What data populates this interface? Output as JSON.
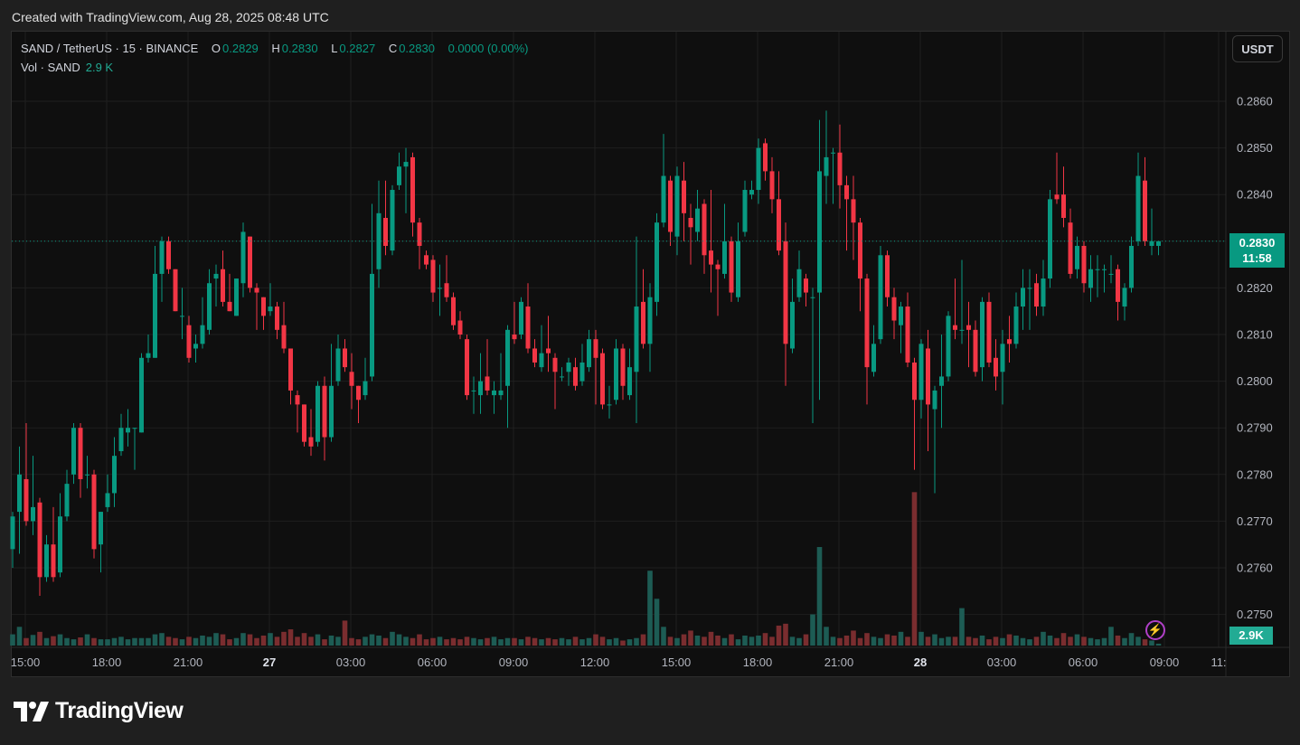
{
  "watermark": "Created with TradingView.com, Aug 28, 2025 08:48 UTC",
  "legend": {
    "symbol": "SAND / TetherUS · 15 · BINANCE",
    "o_label": "O",
    "o": "0.2829",
    "h_label": "H",
    "h": "0.2830",
    "l_label": "L",
    "l": "0.2827",
    "c_label": "C",
    "c": "0.2830",
    "change": "0.0000 (0.00%)"
  },
  "volume_legend": {
    "label": "Vol · SAND",
    "value": "2.9 K"
  },
  "currency_button": "USDT",
  "current_price": {
    "price": "0.2830",
    "countdown": "11:58"
  },
  "current_volume": "2.9K",
  "logo": "TradingView",
  "icons": {
    "alert": "lightning-icon",
    "logo": "tradingview-logo-icon"
  },
  "colors": {
    "up": "#089981",
    "down": "#f23645",
    "vol_up": "#1d5c54",
    "vol_down": "#7a2d2f",
    "alert": "#b040c8"
  },
  "chart_data": {
    "type": "candlestick",
    "title": "SAND / TetherUS · 15 · BINANCE",
    "interval_minutes": 15,
    "ylim": [
      0.2745,
      0.2864
    ],
    "current_price": 0.283,
    "y_ticks": [
      "0.2750",
      "0.2760",
      "0.2770",
      "0.2780",
      "0.2790",
      "0.2800",
      "0.2810",
      "0.2820",
      "0.2830",
      "0.2840",
      "0.2850",
      "0.2860"
    ],
    "x_ticks": [
      {
        "label": "15:00",
        "candle": 3
      },
      {
        "label": "18:00",
        "candle": 15
      },
      {
        "label": "21:00",
        "candle": 27
      },
      {
        "label": "27",
        "candle": 39,
        "bold": true
      },
      {
        "label": "03:00",
        "candle": 51
      },
      {
        "label": "06:00",
        "candle": 63
      },
      {
        "label": "09:00",
        "candle": 75
      },
      {
        "label": "12:00",
        "candle": 87
      },
      {
        "label": "15:00",
        "candle": 99
      },
      {
        "label": "18:00",
        "candle": 111
      },
      {
        "label": "21:00",
        "candle": 123
      },
      {
        "label": "28",
        "candle": 135,
        "bold": true
      },
      {
        "label": "03:00",
        "candle": 147
      },
      {
        "label": "06:00",
        "candle": 159
      },
      {
        "label": "09:00",
        "candle": 171
      },
      {
        "label": "11:",
        "candle": 179
      }
    ],
    "ohlc": [
      [
        0.2764,
        0.2772,
        0.276,
        0.2771
      ],
      [
        0.2772,
        0.2786,
        0.2763,
        0.278
      ],
      [
        0.2779,
        0.2791,
        0.2769,
        0.277
      ],
      [
        0.277,
        0.2784,
        0.2767,
        0.2773
      ],
      [
        0.2774,
        0.2775,
        0.2754,
        0.2758
      ],
      [
        0.2758,
        0.2767,
        0.2757,
        0.2765
      ],
      [
        0.2765,
        0.2773,
        0.2757,
        0.2758
      ],
      [
        0.2759,
        0.2776,
        0.2758,
        0.2771
      ],
      [
        0.2771,
        0.2781,
        0.277,
        0.2778
      ],
      [
        0.278,
        0.2791,
        0.2778,
        0.279
      ],
      [
        0.279,
        0.2791,
        0.2775,
        0.2779
      ],
      [
        0.278,
        0.2784,
        0.2777,
        0.278
      ],
      [
        0.278,
        0.2781,
        0.2762,
        0.2764
      ],
      [
        0.2765,
        0.2772,
        0.2759,
        0.2772
      ],
      [
        0.2773,
        0.278,
        0.2772,
        0.2776
      ],
      [
        0.2776,
        0.2788,
        0.2773,
        0.2784
      ],
      [
        0.2785,
        0.2793,
        0.2784,
        0.279
      ],
      [
        0.2789,
        0.2794,
        0.2786,
        0.279
      ],
      [
        0.279,
        0.279,
        0.2781,
        0.279
      ],
      [
        0.2789,
        0.2806,
        0.2789,
        0.2805
      ],
      [
        0.2805,
        0.281,
        0.2804,
        0.2806
      ],
      [
        0.2805,
        0.2829,
        0.2805,
        0.2823
      ],
      [
        0.2823,
        0.2831,
        0.2817,
        0.283
      ],
      [
        0.283,
        0.2831,
        0.2823,
        0.2824
      ],
      [
        0.2824,
        0.2824,
        0.2815,
        0.2815
      ],
      [
        0.2814,
        0.282,
        0.2809,
        0.2814
      ],
      [
        0.2812,
        0.2814,
        0.2804,
        0.2805
      ],
      [
        0.2807,
        0.281,
        0.2804,
        0.2808
      ],
      [
        0.2808,
        0.2818,
        0.2807,
        0.2812
      ],
      [
        0.2811,
        0.2824,
        0.281,
        0.2821
      ],
      [
        0.2822,
        0.2825,
        0.2816,
        0.2823
      ],
      [
        0.2824,
        0.2828,
        0.2816,
        0.2817
      ],
      [
        0.2817,
        0.2823,
        0.2815,
        0.2815
      ],
      [
        0.2814,
        0.2822,
        0.2814,
        0.2822
      ],
      [
        0.2821,
        0.2834,
        0.2818,
        0.2832
      ],
      [
        0.2831,
        0.2831,
        0.2819,
        0.282
      ],
      [
        0.282,
        0.2821,
        0.2811,
        0.2819
      ],
      [
        0.2818,
        0.2818,
        0.2811,
        0.2814
      ],
      [
        0.2815,
        0.2821,
        0.2814,
        0.2816
      ],
      [
        0.2816,
        0.2817,
        0.2809,
        0.2811
      ],
      [
        0.2812,
        0.2817,
        0.2806,
        0.2807
      ],
      [
        0.2807,
        0.2807,
        0.2795,
        0.2798
      ],
      [
        0.2797,
        0.2798,
        0.2789,
        0.2795
      ],
      [
        0.2795,
        0.2795,
        0.2786,
        0.2787
      ],
      [
        0.2788,
        0.2794,
        0.2784,
        0.2786
      ],
      [
        0.2787,
        0.28,
        0.2786,
        0.2799
      ],
      [
        0.2799,
        0.2801,
        0.2783,
        0.2788
      ],
      [
        0.2788,
        0.2808,
        0.2787,
        0.2799
      ],
      [
        0.28,
        0.281,
        0.2799,
        0.2807
      ],
      [
        0.2807,
        0.2809,
        0.2802,
        0.2803
      ],
      [
        0.2802,
        0.2806,
        0.2794,
        0.2799
      ],
      [
        0.2799,
        0.2799,
        0.2791,
        0.2796
      ],
      [
        0.2797,
        0.2805,
        0.2796,
        0.28
      ],
      [
        0.2801,
        0.2838,
        0.28,
        0.2823
      ],
      [
        0.2824,
        0.2843,
        0.282,
        0.2836
      ],
      [
        0.2835,
        0.2843,
        0.2827,
        0.2829
      ],
      [
        0.2828,
        0.2842,
        0.2827,
        0.2841
      ],
      [
        0.2842,
        0.2849,
        0.2841,
        0.2846
      ],
      [
        0.2846,
        0.285,
        0.2836,
        0.2847
      ],
      [
        0.2848,
        0.2849,
        0.2831,
        0.2834
      ],
      [
        0.2834,
        0.2835,
        0.2824,
        0.2829
      ],
      [
        0.2827,
        0.2828,
        0.2824,
        0.2825
      ],
      [
        0.2826,
        0.2827,
        0.2817,
        0.2819
      ],
      [
        0.282,
        0.2825,
        0.2814,
        0.282
      ],
      [
        0.2821,
        0.2827,
        0.2817,
        0.2818
      ],
      [
        0.2818,
        0.2819,
        0.2811,
        0.2812
      ],
      [
        0.2813,
        0.2815,
        0.2809,
        0.281
      ],
      [
        0.2809,
        0.281,
        0.2796,
        0.2797
      ],
      [
        0.2798,
        0.2801,
        0.2793,
        0.2798
      ],
      [
        0.2797,
        0.2806,
        0.2793,
        0.28
      ],
      [
        0.2801,
        0.2809,
        0.2797,
        0.2798
      ],
      [
        0.2797,
        0.28,
        0.2793,
        0.2798
      ],
      [
        0.2797,
        0.2806,
        0.2796,
        0.2798
      ],
      [
        0.2799,
        0.2812,
        0.279,
        0.2811
      ],
      [
        0.281,
        0.2817,
        0.2808,
        0.2809
      ],
      [
        0.281,
        0.2818,
        0.2809,
        0.2817
      ],
      [
        0.2816,
        0.2821,
        0.2806,
        0.2807
      ],
      [
        0.2807,
        0.2809,
        0.2803,
        0.2804
      ],
      [
        0.2803,
        0.2812,
        0.2802,
        0.2806
      ],
      [
        0.2807,
        0.2814,
        0.2802,
        0.2806
      ],
      [
        0.2805,
        0.2806,
        0.2794,
        0.2802
      ],
      [
        0.2801,
        0.2803,
        0.28,
        0.2801
      ],
      [
        0.2802,
        0.2805,
        0.2799,
        0.2804
      ],
      [
        0.2803,
        0.2805,
        0.2798,
        0.2799
      ],
      [
        0.28,
        0.2808,
        0.2799,
        0.2804
      ],
      [
        0.2803,
        0.2811,
        0.2802,
        0.2809
      ],
      [
        0.2809,
        0.2811,
        0.2795,
        0.2805
      ],
      [
        0.2806,
        0.2807,
        0.2794,
        0.2795
      ],
      [
        0.2795,
        0.2799,
        0.2792,
        0.2795
      ],
      [
        0.2796,
        0.2809,
        0.2795,
        0.2807
      ],
      [
        0.2807,
        0.2808,
        0.2796,
        0.2799
      ],
      [
        0.2797,
        0.2807,
        0.2796,
        0.2803
      ],
      [
        0.2802,
        0.2831,
        0.2791,
        0.2816
      ],
      [
        0.2817,
        0.2824,
        0.2807,
        0.2808
      ],
      [
        0.2808,
        0.2821,
        0.2802,
        0.2818
      ],
      [
        0.2817,
        0.2836,
        0.2814,
        0.2834
      ],
      [
        0.2834,
        0.2853,
        0.2833,
        0.2844
      ],
      [
        0.2843,
        0.2844,
        0.2829,
        0.2832
      ],
      [
        0.2831,
        0.2846,
        0.2827,
        0.2844
      ],
      [
        0.2843,
        0.2847,
        0.283,
        0.2836
      ],
      [
        0.2835,
        0.2838,
        0.2825,
        0.2833
      ],
      [
        0.2832,
        0.2841,
        0.283,
        0.2837
      ],
      [
        0.2838,
        0.2839,
        0.2823,
        0.2827
      ],
      [
        0.2828,
        0.2841,
        0.2819,
        0.2825
      ],
      [
        0.2825,
        0.2826,
        0.2814,
        0.2824
      ],
      [
        0.2823,
        0.2838,
        0.2822,
        0.283
      ],
      [
        0.283,
        0.2831,
        0.2817,
        0.2819
      ],
      [
        0.2818,
        0.2834,
        0.2817,
        0.283
      ],
      [
        0.2832,
        0.2843,
        0.2831,
        0.2841
      ],
      [
        0.284,
        0.2843,
        0.2839,
        0.2841
      ],
      [
        0.2841,
        0.2852,
        0.2838,
        0.285
      ],
      [
        0.2851,
        0.2852,
        0.2843,
        0.2845
      ],
      [
        0.2845,
        0.2848,
        0.2836,
        0.2839
      ],
      [
        0.2839,
        0.2845,
        0.2827,
        0.2828
      ],
      [
        0.283,
        0.2834,
        0.2799,
        0.2808
      ],
      [
        0.2807,
        0.2822,
        0.2806,
        0.2817
      ],
      [
        0.2818,
        0.2828,
        0.2817,
        0.2824
      ],
      [
        0.2822,
        0.2823,
        0.2816,
        0.2819
      ],
      [
        0.2818,
        0.282,
        0.2791,
        0.2818
      ],
      [
        0.2819,
        0.2856,
        0.2796,
        0.2845
      ],
      [
        0.2844,
        0.2858,
        0.2838,
        0.2848
      ],
      [
        0.2849,
        0.285,
        0.2838,
        0.2849
      ],
      [
        0.2849,
        0.2855,
        0.2837,
        0.2842
      ],
      [
        0.2842,
        0.2844,
        0.2828,
        0.2839
      ],
      [
        0.2839,
        0.2844,
        0.2826,
        0.2834
      ],
      [
        0.2834,
        0.2835,
        0.2815,
        0.2822
      ],
      [
        0.2822,
        0.2823,
        0.2795,
        0.2803
      ],
      [
        0.2802,
        0.2812,
        0.2801,
        0.2808
      ],
      [
        0.2809,
        0.2829,
        0.2808,
        0.2827
      ],
      [
        0.2827,
        0.2828,
        0.2816,
        0.2818
      ],
      [
        0.2818,
        0.282,
        0.2809,
        0.2813
      ],
      [
        0.2812,
        0.2817,
        0.2806,
        0.2816
      ],
      [
        0.2816,
        0.2819,
        0.2803,
        0.2804
      ],
      [
        0.2804,
        0.2805,
        0.2781,
        0.2796
      ],
      [
        0.2796,
        0.2809,
        0.2792,
        0.2808
      ],
      [
        0.2807,
        0.2811,
        0.2785,
        0.2795
      ],
      [
        0.2794,
        0.2799,
        0.2776,
        0.2798
      ],
      [
        0.2799,
        0.281,
        0.279,
        0.2801
      ],
      [
        0.2801,
        0.2815,
        0.28,
        0.2814
      ],
      [
        0.2812,
        0.2822,
        0.2809,
        0.2811
      ],
      [
        0.2811,
        0.2826,
        0.2808,
        0.2811
      ],
      [
        0.2812,
        0.2817,
        0.2803,
        0.2811
      ],
      [
        0.2811,
        0.2813,
        0.2801,
        0.2802
      ],
      [
        0.2803,
        0.2818,
        0.28,
        0.2817
      ],
      [
        0.2817,
        0.2819,
        0.2803,
        0.2804
      ],
      [
        0.2805,
        0.2809,
        0.2798,
        0.2801
      ],
      [
        0.2802,
        0.2811,
        0.2795,
        0.2808
      ],
      [
        0.2809,
        0.2814,
        0.2804,
        0.2808
      ],
      [
        0.2808,
        0.2819,
        0.2807,
        0.2816
      ],
      [
        0.2816,
        0.2824,
        0.2811,
        0.282
      ],
      [
        0.282,
        0.2824,
        0.2811,
        0.282
      ],
      [
        0.2821,
        0.2823,
        0.2814,
        0.2816
      ],
      [
        0.2816,
        0.2826,
        0.2814,
        0.2822
      ],
      [
        0.2822,
        0.2841,
        0.282,
        0.2839
      ],
      [
        0.284,
        0.2849,
        0.2838,
        0.2839
      ],
      [
        0.284,
        0.2846,
        0.2833,
        0.2835
      ],
      [
        0.2834,
        0.2837,
        0.2822,
        0.2823
      ],
      [
        0.2824,
        0.2831,
        0.2822,
        0.2829
      ],
      [
        0.2829,
        0.283,
        0.2819,
        0.2821
      ],
      [
        0.282,
        0.2827,
        0.2817,
        0.2824
      ],
      [
        0.2824,
        0.2827,
        0.2818,
        0.2824
      ],
      [
        0.2824,
        0.2825,
        0.2819,
        0.2824
      ],
      [
        0.2823,
        0.2827,
        0.2821,
        0.2823
      ],
      [
        0.2824,
        0.2825,
        0.2813,
        0.2817
      ],
      [
        0.2816,
        0.2821,
        0.2813,
        0.282
      ],
      [
        0.282,
        0.2831,
        0.2819,
        0.2829
      ],
      [
        0.283,
        0.2849,
        0.2829,
        0.2844
      ],
      [
        0.2843,
        0.2848,
        0.2829,
        0.283
      ],
      [
        0.2829,
        0.2837,
        0.2827,
        0.283
      ],
      [
        0.2829,
        0.283,
        0.2827,
        0.283
      ]
    ],
    "volume_k": [
      18,
      30,
      12,
      17,
      22,
      12,
      15,
      18,
      12,
      10,
      13,
      18,
      12,
      10,
      10,
      12,
      14,
      10,
      12,
      12,
      12,
      18,
      20,
      14,
      12,
      10,
      14,
      12,
      16,
      14,
      20,
      18,
      10,
      12,
      20,
      18,
      12,
      16,
      20,
      14,
      22,
      26,
      14,
      20,
      14,
      18,
      10,
      16,
      14,
      40,
      12,
      10,
      14,
      18,
      16,
      12,
      22,
      18,
      14,
      12,
      18,
      10,
      12,
      14,
      10,
      12,
      10,
      14,
      12,
      10,
      12,
      14,
      10,
      12,
      12,
      10,
      14,
      12,
      10,
      12,
      10,
      12,
      10,
      14,
      10,
      12,
      18,
      14,
      10,
      12,
      8,
      10,
      12,
      18,
      120,
      75,
      30,
      14,
      12,
      18,
      24,
      16,
      14,
      22,
      16,
      12,
      18,
      10,
      16,
      14,
      16,
      20,
      14,
      32,
      35,
      14,
      12,
      18,
      50,
      158,
      30,
      14,
      12,
      16,
      24,
      12,
      20,
      14,
      12,
      18,
      16,
      22,
      14,
      246,
      22,
      14,
      18,
      12,
      14,
      14,
      60,
      14,
      12,
      16,
      10,
      14,
      12,
      18,
      16,
      12,
      10,
      14,
      22,
      16,
      12,
      20,
      14,
      18,
      14,
      12,
      10,
      12,
      30,
      16,
      12,
      20,
      14,
      10,
      8,
      3
    ]
  }
}
